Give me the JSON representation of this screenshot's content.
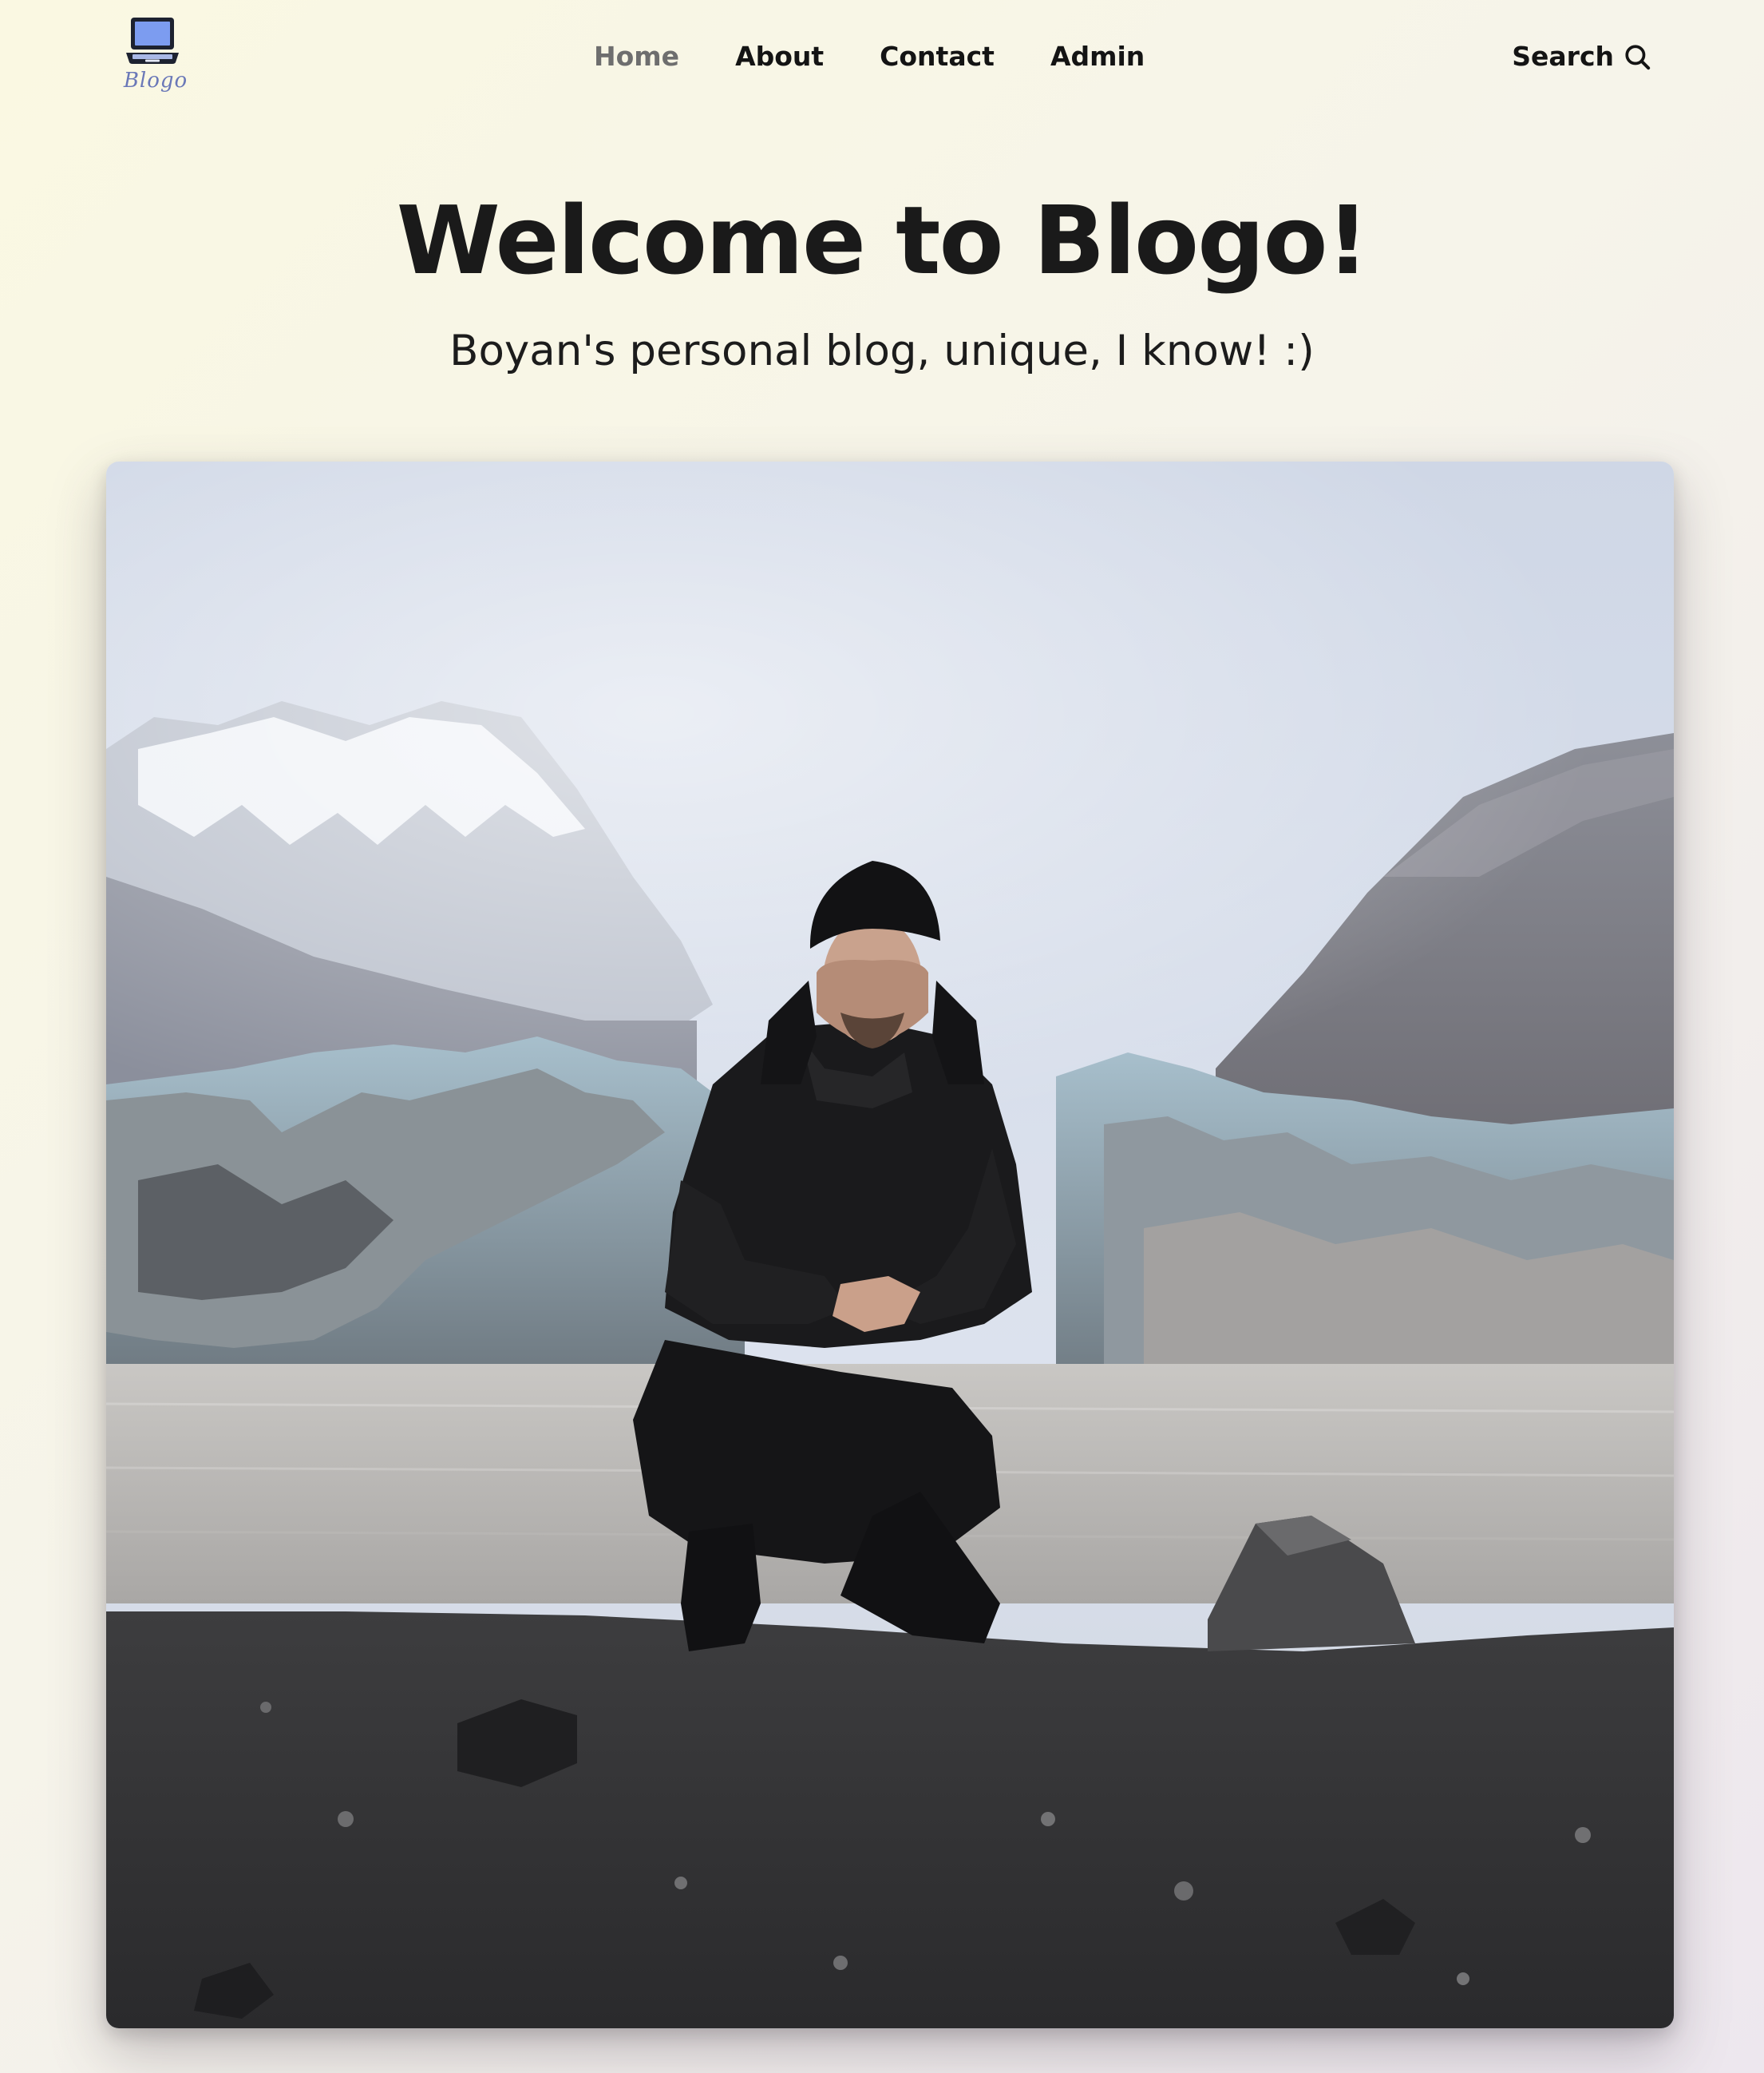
{
  "header": {
    "logo": {
      "icon": "laptop-icon",
      "text": "Blogo"
    },
    "nav": [
      {
        "label": "Home",
        "active": true
      },
      {
        "label": "About",
        "active": false
      },
      {
        "label": "Contact",
        "active": false
      },
      {
        "label": "Admin",
        "active": false
      }
    ],
    "search": {
      "label": "Search",
      "icon": "search-icon"
    }
  },
  "hero": {
    "title": "Welcome to Blogo!",
    "subtitle": "Boyan's personal blog, unique, I know! :)"
  },
  "photo": {
    "scene": "Person crouching on dark volcanic gravel in front of a glacier lagoon with snowy mountains"
  },
  "colors": {
    "accent_active_nav": "#6e6e6e",
    "text": "#141414",
    "logo_blue": "#6a78b8"
  }
}
